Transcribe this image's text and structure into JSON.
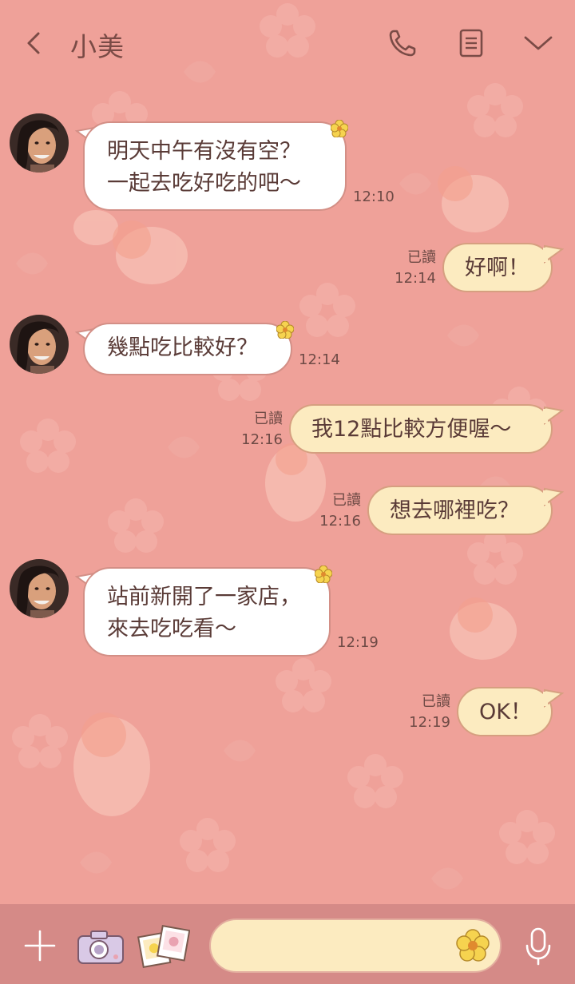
{
  "header": {
    "title": "小美",
    "icons": [
      "back-icon",
      "phone-icon",
      "notes-icon",
      "chevron-down-icon"
    ]
  },
  "messages": [
    {
      "direction": "in",
      "lines": [
        "明天中午有沒有空？",
        "一起去吃好吃的吧～"
      ],
      "time": "12:10"
    },
    {
      "direction": "out",
      "text": "好啊！",
      "read": "已讀",
      "time": "12:14"
    },
    {
      "direction": "in",
      "lines": [
        "幾點吃比較好？"
      ],
      "time": "12:14"
    },
    {
      "direction": "out",
      "text": "我12點比較方便喔～",
      "read": "已讀",
      "time": "12:16"
    },
    {
      "direction": "out",
      "text": "想去哪裡吃？",
      "read": "已讀",
      "time": "12:16"
    },
    {
      "direction": "in",
      "lines": [
        "站前新開了一家店，",
        "來去吃吃看～"
      ],
      "time": "12:19"
    },
    {
      "direction": "out",
      "text": "OK！",
      "read": "已讀",
      "time": "12:19"
    }
  ],
  "bottom_bar": {
    "input_value": "",
    "icons": [
      "plus-icon",
      "camera-icon",
      "photo-icon",
      "flower-icon",
      "microphone-icon"
    ]
  },
  "colors": {
    "background": "#EFA199",
    "incoming_bubble": "#FFFFFF",
    "outgoing_bubble": "#FCEBC0",
    "bottom_bar": "#D58A87",
    "text": "#5A3B37"
  }
}
